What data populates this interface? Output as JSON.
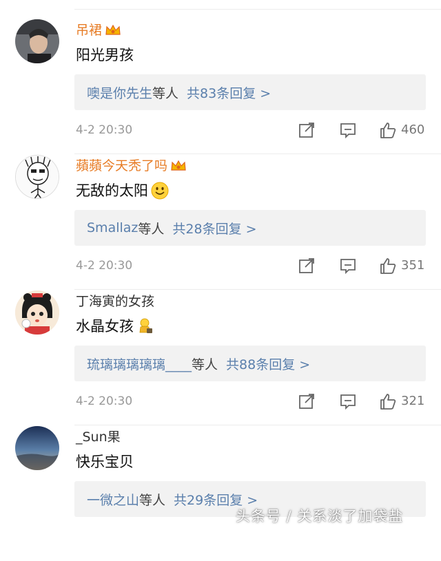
{
  "comments": [
    {
      "username": "吊裙",
      "vip": true,
      "text": "阳光男孩",
      "reply": {
        "names": "噢是你先生",
        "suffix": "等人",
        "count": "共83条回复 >"
      },
      "time": "4-2 20:30",
      "likes": "460",
      "avatar_icon": "avatar-photo-young-man"
    },
    {
      "username": "蘋蘋今天秃了吗",
      "vip": true,
      "text": "无敌的太阳",
      "emoji": "smile-emoji",
      "reply": {
        "names": "Smallaz",
        "suffix": "等人",
        "count": "共28条回复 >"
      },
      "time": "4-2 20:30",
      "likes": "351",
      "avatar_icon": "avatar-sketch-face"
    },
    {
      "username": "丁海寅的女孩",
      "vip": false,
      "text": "水晶女孩",
      "emoji": "yellow-figure-emoji",
      "reply": {
        "names": "琉璃璃璃璃璃____",
        "suffix": "等人",
        "count": "共88条回复 >"
      },
      "time": "4-2 20:30",
      "likes": "321",
      "avatar_icon": "avatar-cartoon-girl"
    },
    {
      "username": "_Sun果",
      "vip": false,
      "text": "快乐宝贝",
      "reply": {
        "names": "一微之山",
        "suffix": "等人",
        "count": "共29条回复 >"
      },
      "time": "",
      "likes": "",
      "avatar_icon": "avatar-sky-photo"
    }
  ],
  "watermark": "头条号 / 关系淡了加袋盐",
  "colors": {
    "vip_name": "#e77c25",
    "link": "#5a7fac",
    "meta": "#999999",
    "reply_bg": "#f2f2f2"
  }
}
